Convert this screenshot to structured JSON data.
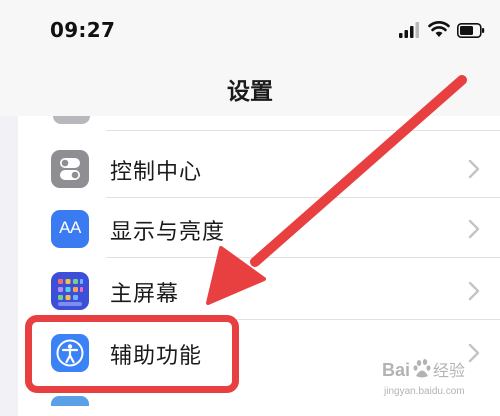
{
  "status_bar": {
    "time": "09:27",
    "icons": [
      "signal-icon",
      "wifi-icon",
      "battery-icon"
    ]
  },
  "header": {
    "title": "设置"
  },
  "settings": {
    "items": [
      {
        "label": "控制中心",
        "icon": "control-center-icon",
        "color": "#8e8e93"
      },
      {
        "label": "显示与亮度",
        "icon": "display-brightness-icon",
        "color": "#3a7bf2",
        "icon_text": "AA"
      },
      {
        "label": "主屏幕",
        "icon": "home-screen-icon",
        "color": "#3d4fd9"
      },
      {
        "label": "辅助功能",
        "icon": "accessibility-icon",
        "color": "#3b82f6"
      }
    ]
  },
  "annotation": {
    "highlight_color": "#e84040",
    "highlighted_item": "辅助功能"
  },
  "watermark": {
    "brand": "Baidu经验",
    "url": "jingyan.baidu.com"
  }
}
